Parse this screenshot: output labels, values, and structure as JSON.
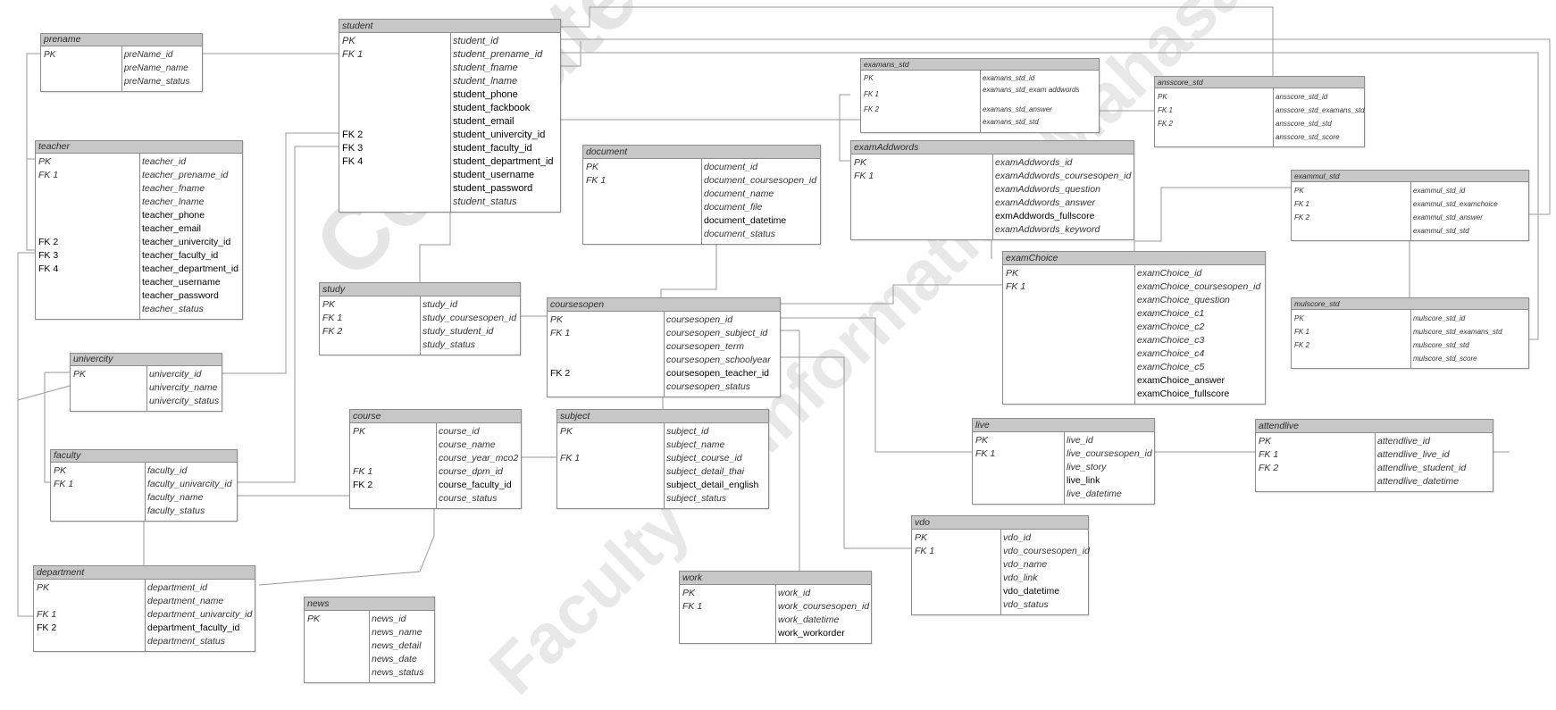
{
  "watermark": {
    "line1": "Computer Science Department",
    "line2": "Faculty of Informatics, Mahasarakham University"
  },
  "entities": {
    "prename": {
      "name": "prename",
      "rows": [
        {
          "key": "PK",
          "attr": "preName_id"
        },
        {
          "key": "",
          "attr": "preName_name"
        },
        {
          "key": "",
          "attr": "preName_status"
        }
      ]
    },
    "student": {
      "name": "student",
      "rows": [
        {
          "key": "PK",
          "attr": "student_id"
        },
        {
          "key": "FK 1",
          "attr": "student_prename_id"
        },
        {
          "key": "",
          "attr": "student_fname"
        },
        {
          "key": "",
          "attr": "student_lname"
        },
        {
          "key": "",
          "attr": "student_phone",
          "upright": true
        },
        {
          "key": "",
          "attr": "student_fackbook",
          "upright": true
        },
        {
          "key": "",
          "attr": "student_email",
          "upright": true
        },
        {
          "key": "FK 2",
          "attr": "student_univercity_id",
          "upright": true
        },
        {
          "key": "FK 3",
          "attr": "student_faculty_id",
          "upright": true
        },
        {
          "key": "FK 4",
          "attr": "student_department_id",
          "upright": true
        },
        {
          "key": "",
          "attr": "student_username",
          "upright": true
        },
        {
          "key": "",
          "attr": "student_password",
          "upright": true
        },
        {
          "key": "",
          "attr": "student_status"
        }
      ]
    },
    "teacher": {
      "name": "teacher",
      "rows": [
        {
          "key": "PK",
          "attr": "teacher_id"
        },
        {
          "key": "FK 1",
          "attr": "teacher_prename_id"
        },
        {
          "key": "",
          "attr": "teacher_fname"
        },
        {
          "key": "",
          "attr": "teacher_lname"
        },
        {
          "key": "",
          "attr": "teacher_phone",
          "upright": true
        },
        {
          "key": "",
          "attr": "teacher_email",
          "upright": true
        },
        {
          "key": "FK 2",
          "attr": "teacher_univercity_id",
          "upright": true
        },
        {
          "key": "FK 3",
          "attr": "teacher_faculty_id",
          "upright": true
        },
        {
          "key": "FK 4",
          "attr": "teacher_department_id",
          "upright": true
        },
        {
          "key": "",
          "attr": "teacher_username",
          "upright": true
        },
        {
          "key": "",
          "attr": "teacher_password",
          "upright": true
        },
        {
          "key": "",
          "attr": "teacher_status"
        }
      ]
    },
    "univercity": {
      "name": "univercity",
      "rows": [
        {
          "key": "PK",
          "attr": "univercity_id"
        },
        {
          "key": "",
          "attr": "univercity_name"
        },
        {
          "key": "",
          "attr": "univercity_status"
        }
      ]
    },
    "faculty": {
      "name": "faculty",
      "rows": [
        {
          "key": "PK",
          "attr": "faculty_id"
        },
        {
          "key": "FK 1",
          "attr": "faculty_univarcity_id"
        },
        {
          "key": "",
          "attr": "faculty_name"
        },
        {
          "key": "",
          "attr": "faculty_status"
        }
      ]
    },
    "department": {
      "name": "department",
      "rows": [
        {
          "key": "PK",
          "attr": "department_id"
        },
        {
          "key": "",
          "attr": "department_name"
        },
        {
          "key": "FK 1",
          "attr": "department_univarcity_id"
        },
        {
          "key": "FK 2",
          "attr": "department_faculty_id",
          "upright": true,
          "keyUpright": true
        },
        {
          "key": "",
          "attr": "department_status"
        }
      ]
    },
    "news": {
      "name": "news",
      "rows": [
        {
          "key": "PK",
          "attr": "news_id"
        },
        {
          "key": "",
          "attr": "news_name"
        },
        {
          "key": "",
          "attr": "news_detail"
        },
        {
          "key": "",
          "attr": "news_date"
        },
        {
          "key": "",
          "attr": "news_status"
        }
      ]
    },
    "study": {
      "name": "study",
      "rows": [
        {
          "key": "PK",
          "attr": "study_id"
        },
        {
          "key": "FK 1",
          "attr": "study_coursesopen_id"
        },
        {
          "key": "FK 2",
          "attr": "study_student_id"
        },
        {
          "key": "",
          "attr": "study_status"
        }
      ]
    },
    "course": {
      "name": "course",
      "rows": [
        {
          "key": "PK",
          "attr": "course_id"
        },
        {
          "key": "",
          "attr": "course_name"
        },
        {
          "key": "",
          "attr": "course_year_mco2"
        },
        {
          "key": "FK 1",
          "attr": "course_dpm_id"
        },
        {
          "key": "FK 2",
          "attr": "course_faculty_id",
          "upright": true,
          "keyUpright": true
        },
        {
          "key": "",
          "attr": "course_status"
        }
      ]
    },
    "document": {
      "name": "document",
      "rows": [
        {
          "key": "PK",
          "attr": "document_id"
        },
        {
          "key": "FK 1",
          "attr": "document_coursesopen_id"
        },
        {
          "key": "",
          "attr": "document_name"
        },
        {
          "key": "",
          "attr": "document_file"
        },
        {
          "key": "",
          "attr": "document_datetime",
          "upright": true
        },
        {
          "key": "",
          "attr": "document_status"
        }
      ]
    },
    "coursesopen": {
      "name": "coursesopen",
      "rows": [
        {
          "key": "PK",
          "attr": "coursesopen_id"
        },
        {
          "key": "FK 1",
          "attr": "coursesopen_subject_id"
        },
        {
          "key": "",
          "attr": "coursesopen_term"
        },
        {
          "key": "",
          "attr": "coursesopen_schoolyear"
        },
        {
          "key": "FK 2",
          "attr": "coursesopen_teacher_id",
          "upright": true,
          "keyUpright": true
        },
        {
          "key": "",
          "attr": "coursesopen_status"
        }
      ]
    },
    "subject": {
      "name": "subject",
      "rows": [
        {
          "key": "PK",
          "attr": "subject_id"
        },
        {
          "key": "",
          "attr": "subject_name"
        },
        {
          "key": "FK 1",
          "attr": "subject_course_id"
        },
        {
          "key": "",
          "attr": "subject_detail_thai"
        },
        {
          "key": "",
          "attr": "subject_detail_english",
          "upright": true
        },
        {
          "key": "",
          "attr": "subject_status"
        }
      ]
    },
    "work": {
      "name": "work",
      "rows": [
        {
          "key": "PK",
          "attr": "work_id"
        },
        {
          "key": "FK 1",
          "attr": "work_coursesopen_id"
        },
        {
          "key": "",
          "attr": "work_datetime"
        },
        {
          "key": "",
          "attr": "work_workorder",
          "upright": true
        }
      ]
    },
    "examans_std": {
      "name": "examans_std",
      "rows": [
        {
          "key": "PK",
          "attr": "examans_std_id"
        },
        {
          "key": "FK 1",
          "attr": "examans_std_exam addwords"
        },
        {
          "key": "FK 2",
          "attr": "examans_std_answer"
        },
        {
          "key": "",
          "attr": "examans_std_std"
        }
      ]
    },
    "examAddwords": {
      "name": "examAddwords",
      "rows": [
        {
          "key": "PK",
          "attr": "examAddwords_id"
        },
        {
          "key": "FK 1",
          "attr": "examAddwords_coursesopen_id"
        },
        {
          "key": "",
          "attr": "examAddwords_question"
        },
        {
          "key": "",
          "attr": "examAddwords_answer"
        },
        {
          "key": "",
          "attr": "exmAddwords_fullscore",
          "upright": true
        },
        {
          "key": "",
          "attr": "examAddwords_keyword"
        }
      ]
    },
    "examChoice": {
      "name": "examChoice",
      "rows": [
        {
          "key": "PK",
          "attr": "examChoice_id"
        },
        {
          "key": "FK 1",
          "attr": "examChoice_coursesopen_id"
        },
        {
          "key": "",
          "attr": "examChoice_question"
        },
        {
          "key": "",
          "attr": "examChoice_c1"
        },
        {
          "key": "",
          "attr": "examChoice_c2"
        },
        {
          "key": "",
          "attr": "examChoice_c3"
        },
        {
          "key": "",
          "attr": "examChoice_c4"
        },
        {
          "key": "",
          "attr": "examChoice_c5"
        },
        {
          "key": "",
          "attr": "examChoice_answer",
          "upright": true
        },
        {
          "key": "",
          "attr": "examChoice_fullscore",
          "upright": true
        }
      ]
    },
    "live": {
      "name": "live",
      "rows": [
        {
          "key": "PK",
          "attr": "live_id"
        },
        {
          "key": "FK 1",
          "attr": "live_coursesopen_id"
        },
        {
          "key": "",
          "attr": "live_story"
        },
        {
          "key": "",
          "attr": "live_link",
          "upright": true
        },
        {
          "key": "",
          "attr": "live_datetime"
        }
      ]
    },
    "vdo": {
      "name": "vdo",
      "rows": [
        {
          "key": "PK",
          "attr": "vdo_id"
        },
        {
          "key": "FK 1",
          "attr": "vdo_coursesopen_id"
        },
        {
          "key": "",
          "attr": "vdo_name"
        },
        {
          "key": "",
          "attr": "vdo_link"
        },
        {
          "key": "",
          "attr": "vdo_datetime",
          "upright": true
        },
        {
          "key": "",
          "attr": "vdo_status"
        }
      ]
    },
    "ansscore_std": {
      "name": "ansscore_std",
      "rows": [
        {
          "key": "PK",
          "attr": "ansscore_std_id"
        },
        {
          "key": "FK 1",
          "attr": "ansscore_std_examans_std"
        },
        {
          "key": "FK 2",
          "attr": "ansscore_std_std"
        },
        {
          "key": "",
          "attr": "ansscore_std_score"
        }
      ]
    },
    "exammul_std": {
      "name": "exammul_std",
      "rows": [
        {
          "key": "PK",
          "attr": "exammul_std_id"
        },
        {
          "key": "FK 1",
          "attr": "exammul_std_examchoice"
        },
        {
          "key": "FK 2",
          "attr": "exammul_std_answer"
        },
        {
          "key": "",
          "attr": "exammul_std_std"
        }
      ]
    },
    "mulscore_std": {
      "name": "mulscore_std",
      "rows": [
        {
          "key": "PK",
          "attr": "mulscore_std_id"
        },
        {
          "key": "FK 1",
          "attr": "mulscore_std_examans_std"
        },
        {
          "key": "FK 2",
          "attr": "mulscore_std_std"
        },
        {
          "key": "",
          "attr": "mulscore_std_score"
        }
      ]
    },
    "attendlive": {
      "name": "attendlive",
      "rows": [
        {
          "key": "PK",
          "attr": "attendlive_id"
        },
        {
          "key": "FK 1",
          "attr": "attendlive_live_id"
        },
        {
          "key": "FK 2",
          "attr": "attendlive_student_id"
        },
        {
          "key": "",
          "attr": "attendlive_datetime"
        }
      ]
    }
  }
}
